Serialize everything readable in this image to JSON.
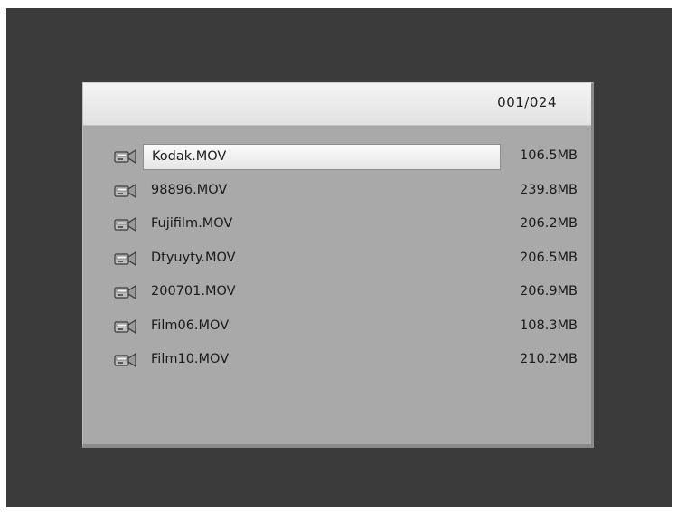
{
  "header": {
    "page_counter": "001/024"
  },
  "files": [
    {
      "name": "Kodak.MOV",
      "size": "106.5MB",
      "icon": "video-file-icon",
      "selected": true
    },
    {
      "name": "98896.MOV",
      "size": "239.8MB",
      "icon": "video-file-icon",
      "selected": false
    },
    {
      "name": "Fujifilm.MOV",
      "size": "206.2MB",
      "icon": "video-file-icon",
      "selected": false
    },
    {
      "name": "Dtyuyty.MOV",
      "size": "206.5MB",
      "icon": "video-file-icon",
      "selected": false
    },
    {
      "name": "200701.MOV",
      "size": "206.9MB",
      "icon": "video-file-icon",
      "selected": false
    },
    {
      "name": "Film06.MOV",
      "size": "108.3MB",
      "icon": "video-file-icon",
      "selected": false
    },
    {
      "name": "Film10.MOV",
      "size": "210.2MB",
      "icon": "video-file-icon",
      "selected": false
    }
  ],
  "colors": {
    "screen_background": "#3b3b3b",
    "panel_background": "#a9a9a9",
    "header_background": "#ececec",
    "selection_background": "#f2f2f2",
    "text": "#1a1a1a"
  }
}
